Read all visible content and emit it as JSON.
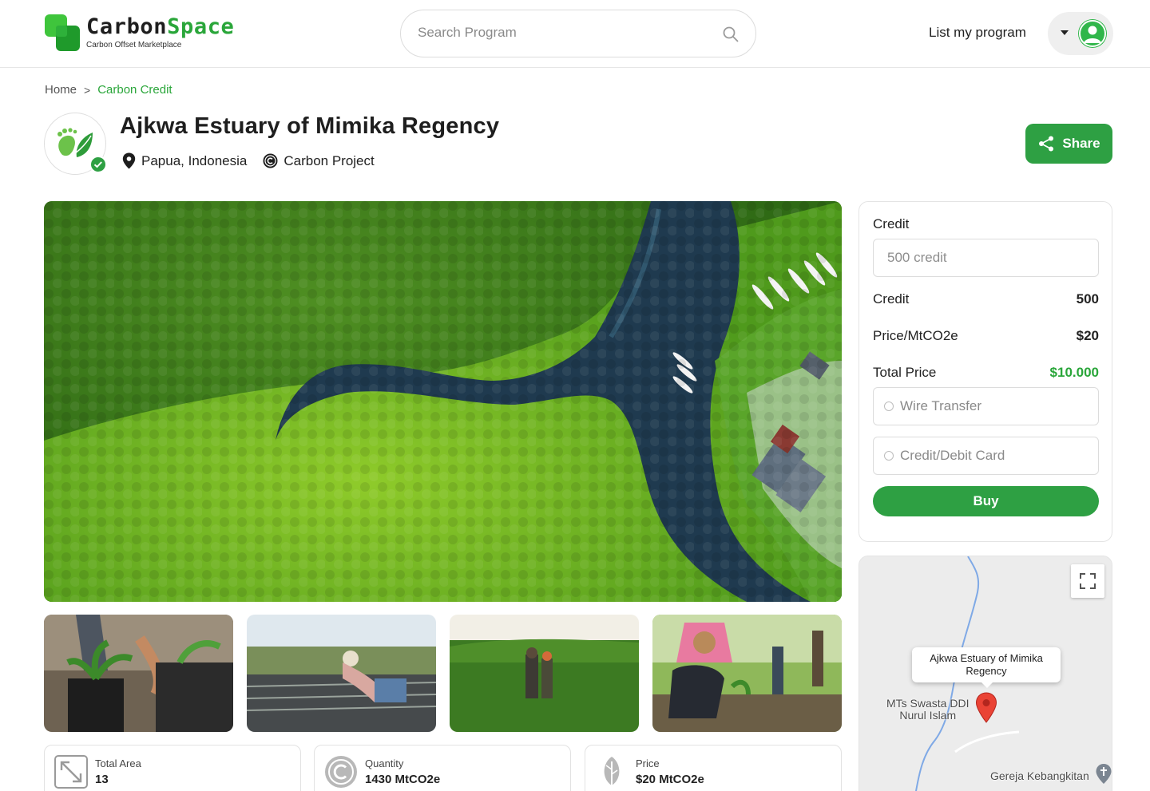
{
  "brand": {
    "name_part1": "Carbon",
    "name_part2": "Space",
    "tagline": "Carbon Offset Marketplace",
    "colors": {
      "primary": "#2ea043",
      "accent": "#2aa63a",
      "dark": "#1e1e1e"
    }
  },
  "header": {
    "search_placeholder": "Search Program",
    "list_program_label": "List my program",
    "user_menu_icon": "chevron-down-icon",
    "avatar_icon": "user-avatar-icon"
  },
  "breadcrumb": {
    "home": "Home",
    "separator": ">",
    "current": "Carbon Credit"
  },
  "program": {
    "title": "Ajkwa Estuary of Mimika Regency",
    "location": "Papua, Indonesia",
    "category": "Carbon Project",
    "share_label": "Share"
  },
  "gallery": {
    "hero_alt": "aerial mangrove forest with river",
    "thumbnails": [
      "planting seedling",
      "nursery worker",
      "workers in plantation",
      "woman planting"
    ]
  },
  "stats": [
    {
      "label": "Total Area",
      "value": "13",
      "icon": "resize-arrow-icon"
    },
    {
      "label": "Quantity",
      "value": "1430 MtCO2e",
      "icon": "copyright-c-icon"
    },
    {
      "label": "Price",
      "value": "$20 MtCO2e",
      "icon": "leaf-icon"
    }
  ],
  "purchase": {
    "credit_label": "Credit",
    "credit_placeholder": "500 credit",
    "rows": [
      {
        "label": "Credit",
        "value": "500"
      },
      {
        "label": "Price/MtCO2e",
        "value": "$20"
      },
      {
        "label": "Total Price",
        "value": "$10.000"
      }
    ],
    "payment_options": [
      "Wire Transfer",
      "Credit/Debit Card"
    ],
    "buy_label": "Buy"
  },
  "map": {
    "popup_line1": "Ajkwa Estuary of Mimika",
    "popup_line2": "Regency",
    "label_school_line1": "MTs Swasta DDI",
    "label_school_line2": "Nurul Islam",
    "label_church": "Gereja Kebangkitan"
  }
}
